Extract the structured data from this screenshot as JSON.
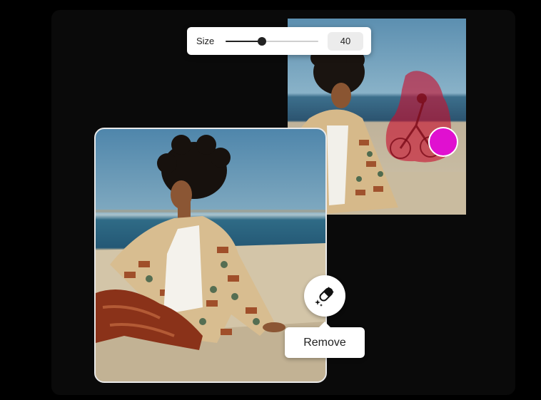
{
  "size_control": {
    "label": "Size",
    "value": "40",
    "slider_fraction": 0.39
  },
  "eraser": {
    "icon": "eraser-icon"
  },
  "remove": {
    "label": "Remove"
  },
  "colors": {
    "brush": "#e010d0",
    "selection_mask": "#c8102e"
  }
}
